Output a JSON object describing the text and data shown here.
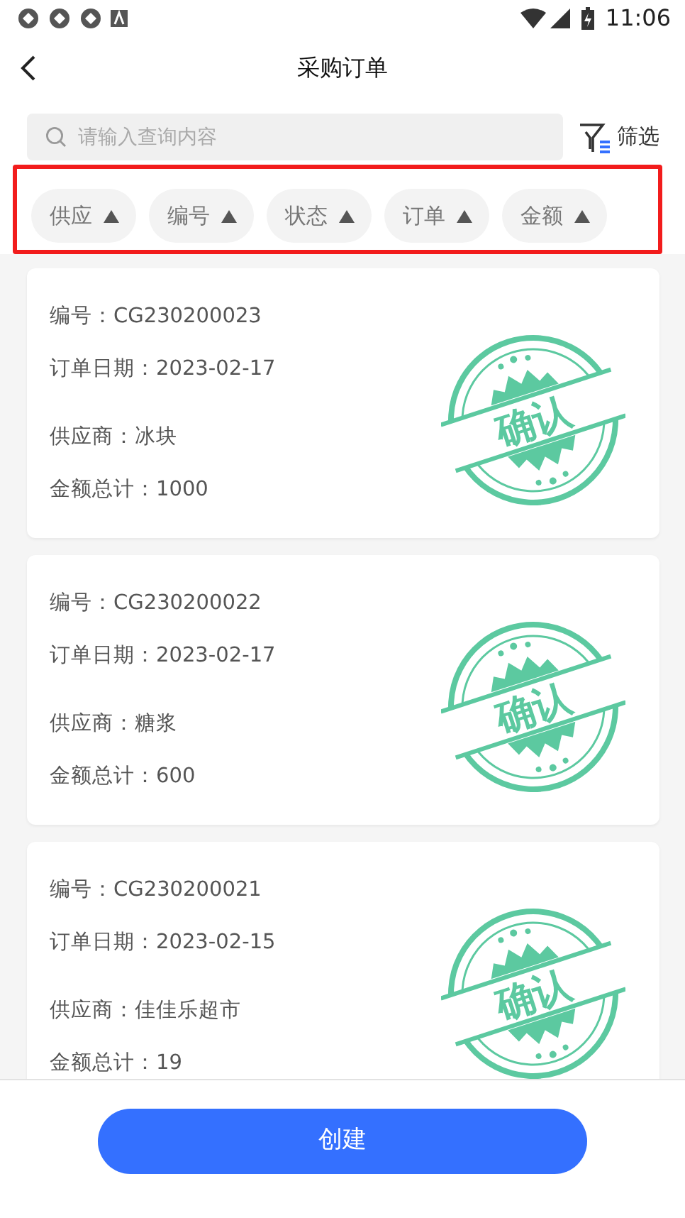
{
  "status_bar": {
    "time": "11:06"
  },
  "header": {
    "title": "采购订单"
  },
  "search": {
    "placeholder": "请输入查询内容"
  },
  "filter": {
    "label": "筛选"
  },
  "sort_chips": [
    {
      "label": "供应"
    },
    {
      "label": "编号"
    },
    {
      "label": "状态"
    },
    {
      "label": "订单"
    },
    {
      "label": "金额"
    }
  ],
  "orders": [
    {
      "number": "编号：CG230200023",
      "date": "订单日期：2023-02-17",
      "supplier": "供应商：冰块",
      "total": "金额总计：1000",
      "stamp": "确认"
    },
    {
      "number": "编号：CG230200022",
      "date": "订单日期：2023-02-17",
      "supplier": "供应商：糖浆",
      "total": "金额总计：600",
      "stamp": "确认"
    },
    {
      "number": "编号：CG230200021",
      "date": "订单日期：2023-02-15",
      "supplier": "供应商：佳佳乐超市",
      "total": "金额总计：19",
      "stamp": "确认"
    }
  ],
  "create_button": {
    "label": "创建"
  }
}
